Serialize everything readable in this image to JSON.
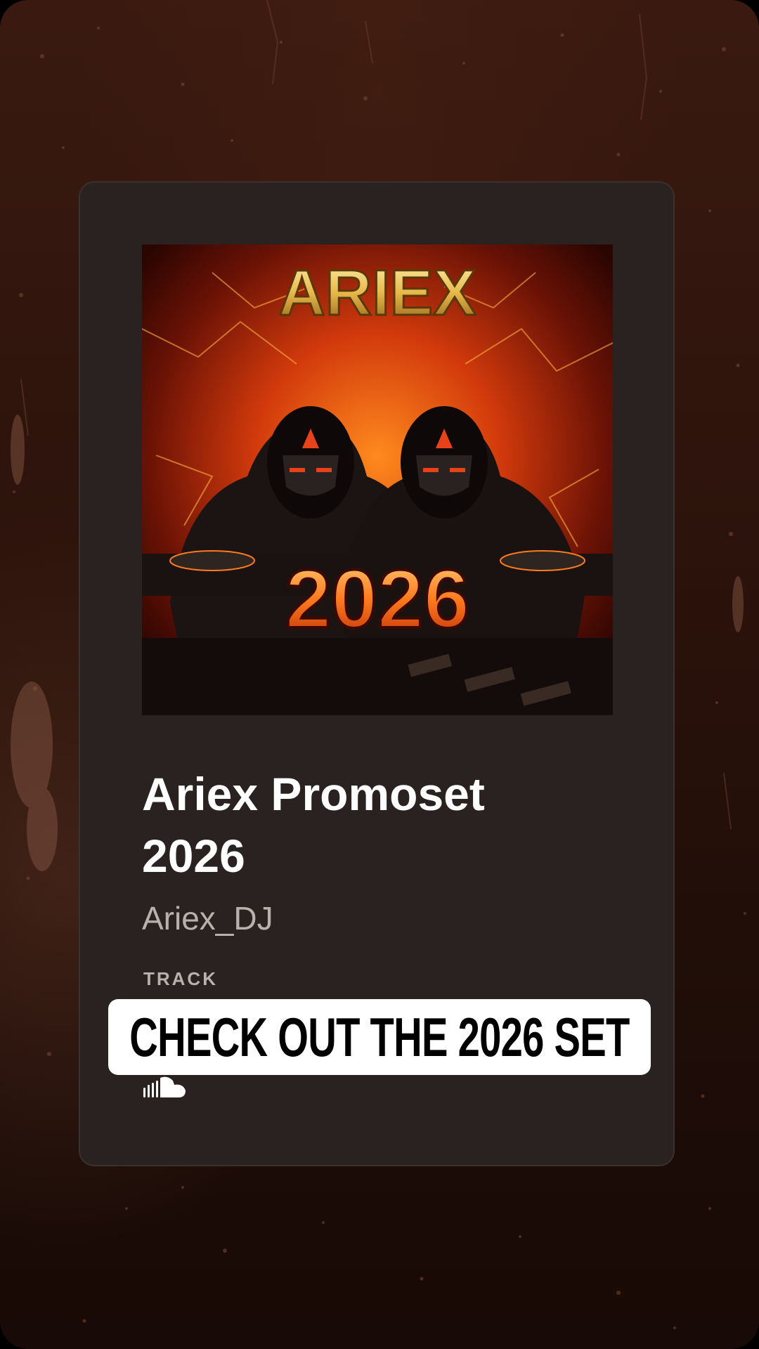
{
  "card": {
    "artwork": {
      "brand_text": "ARIEX",
      "year_text": "2026",
      "description_icon": "album-artwork"
    },
    "title": "Ariex Promoset 2026",
    "artist": "Ariex_DJ",
    "type_label": "TRACK",
    "service_icon": "soundcloud-icon"
  },
  "sticker": {
    "text": "CHECK OUT THE 2026 SET"
  },
  "colors": {
    "background": "#2c130b",
    "card": "#2a2220",
    "accent_orange": "#e8521a",
    "gold": "#e6b84a",
    "sticker_bg": "#ffffff"
  }
}
